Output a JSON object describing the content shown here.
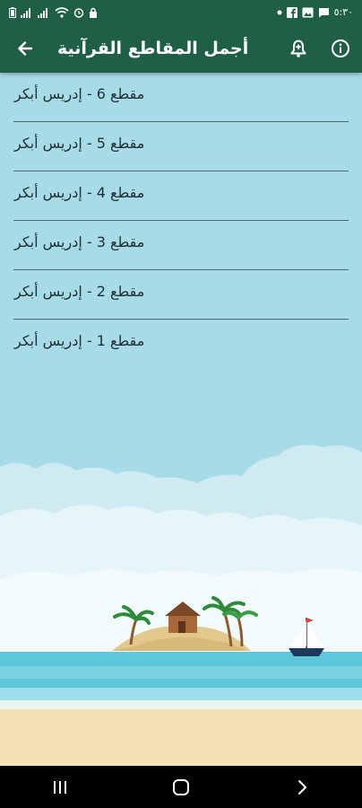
{
  "status_bar": {
    "time": "٥:٣٠",
    "left_icons": [
      "battery-icon",
      "signal-icon",
      "signal-icon",
      "wifi-icon",
      "alarm-icon",
      "lock-icon"
    ],
    "right_icons": [
      "dot-icon",
      "facebook-icon",
      "gallery-icon",
      "chat-icon"
    ]
  },
  "toolbar": {
    "title": "أجمل المقاطع القرآنية",
    "icons": [
      "back-arrow-icon",
      "bell-icon",
      "info-icon"
    ]
  },
  "list": {
    "items": [
      {
        "label": "مقطع 6 - إدريس أبكر"
      },
      {
        "label": "مقطع 5 - إدريس أبكر"
      },
      {
        "label": "مقطع 4 - إدريس أبكر"
      },
      {
        "label": "مقطع 3 - إدريس أبكر"
      },
      {
        "label": "مقطع 2 - إدريس أبكر"
      },
      {
        "label": "مقطع 1 - إدريس أبكر"
      }
    ]
  },
  "navigation_bar": {
    "icons": [
      "recents-icon",
      "home-icon",
      "back-chevron-icon"
    ]
  },
  "colors": {
    "toolbar": "#1f5f45",
    "background": "#a7dbe7",
    "divider": "#4e6b73",
    "item_text": "#223035",
    "sea": "#5ec7d9",
    "sand": "#f2e2b6"
  }
}
